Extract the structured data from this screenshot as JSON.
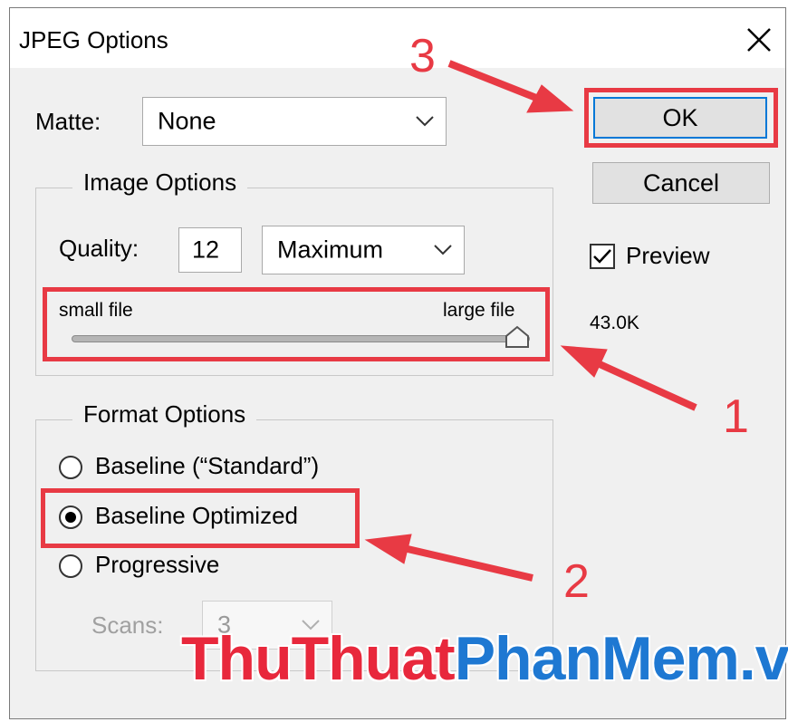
{
  "window": {
    "title": "JPEG Options"
  },
  "matte": {
    "label": "Matte:",
    "value": "None"
  },
  "image_options": {
    "legend": "Image Options",
    "quality_label": "Quality:",
    "quality_value": "12",
    "quality_preset": "Maximum",
    "slider_min_label": "small file",
    "slider_max_label": "large file",
    "slider_level": 1.0
  },
  "format_options": {
    "legend": "Format Options",
    "options": [
      {
        "label": "Baseline (“Standard”)",
        "checked": false
      },
      {
        "label": "Baseline Optimized",
        "checked": true
      },
      {
        "label": "Progressive",
        "checked": false
      }
    ],
    "scans_label": "Scans:",
    "scans_value": "3"
  },
  "buttons": {
    "ok": "OK",
    "cancel": "Cancel"
  },
  "preview": {
    "label": "Preview",
    "checked": true,
    "file_size": "43.0K"
  },
  "annotations": {
    "step1": "1",
    "step2": "2",
    "step3": "3",
    "color": "#e83a44"
  },
  "watermark": {
    "part1": "ThuThuat",
    "part2": "PhanMem",
    "part3": ".vn",
    "color1": "#e8283c",
    "color2": "#1e78d2"
  },
  "colors": {
    "dialog_bg": "#f0f0f0",
    "default_button_border": "#0078d7"
  }
}
